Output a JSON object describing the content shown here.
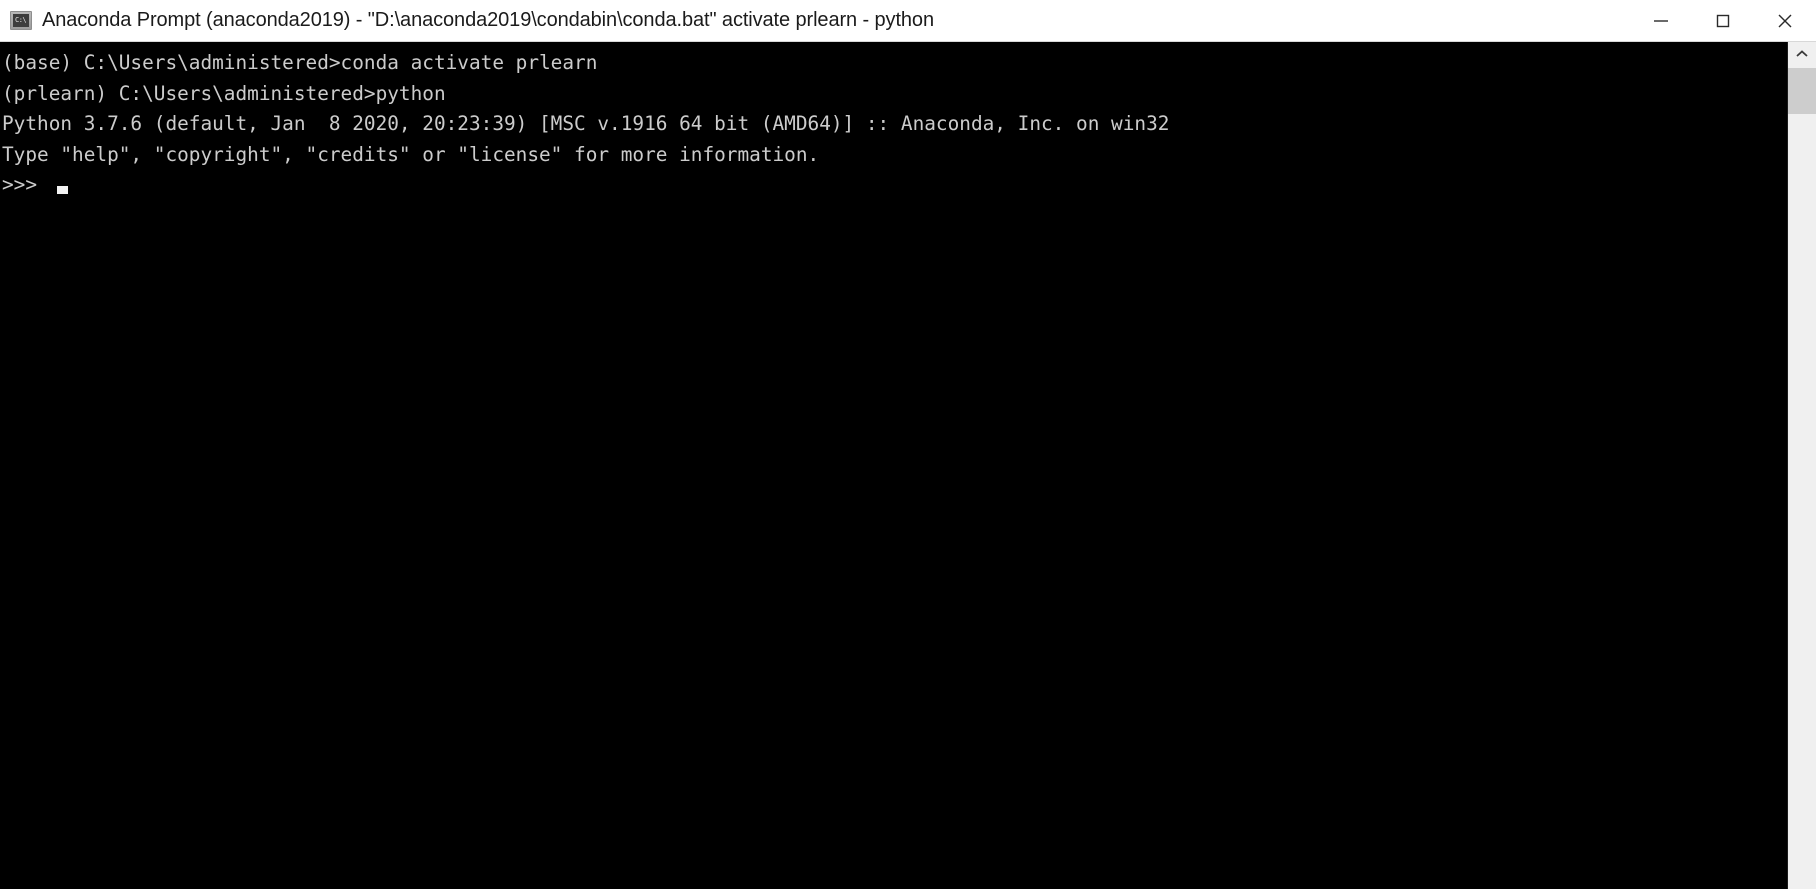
{
  "window": {
    "title": "Anaconda Prompt (anaconda2019) - \"D:\\anaconda2019\\condabin\\conda.bat\"  activate prlearn - python",
    "icon": "console-icon",
    "icon_glyph": "C:\\",
    "background_color": "#000000",
    "titlebar_color": "#ffffff",
    "text_color": "#cccccc"
  },
  "window_controls": {
    "minimize_label": "Minimize",
    "maximize_label": "Maximize",
    "close_label": "Close"
  },
  "terminal": {
    "lines": [
      "",
      "(base) C:\\Users\\administered>conda activate prlearn",
      "",
      "(prlearn) C:\\Users\\administered>python",
      "Python 3.7.6 (default, Jan  8 2020, 20:23:39) [MSC v.1916 64 bit (AMD64)] :: Anaconda, Inc. on win32",
      "Type \"help\", \"copyright\", \"credits\" or \"license\" for more information."
    ],
    "prompt": ">>>",
    "cursor": "block-cursor",
    "environments": {
      "base": "(base)",
      "active": "(prlearn)"
    },
    "cwd": "C:\\Users\\administered",
    "commands": [
      "conda activate prlearn",
      "python"
    ],
    "python_version": "3.7.6",
    "build_date": "Jan  8 2020, 20:23:39",
    "compiler": "MSC v.1916 64 bit (AMD64)",
    "distribution": "Anaconda, Inc.",
    "platform": "win32"
  },
  "scrollbar": {
    "up_arrow": "chevron-up-icon",
    "thumb_position": "top"
  }
}
